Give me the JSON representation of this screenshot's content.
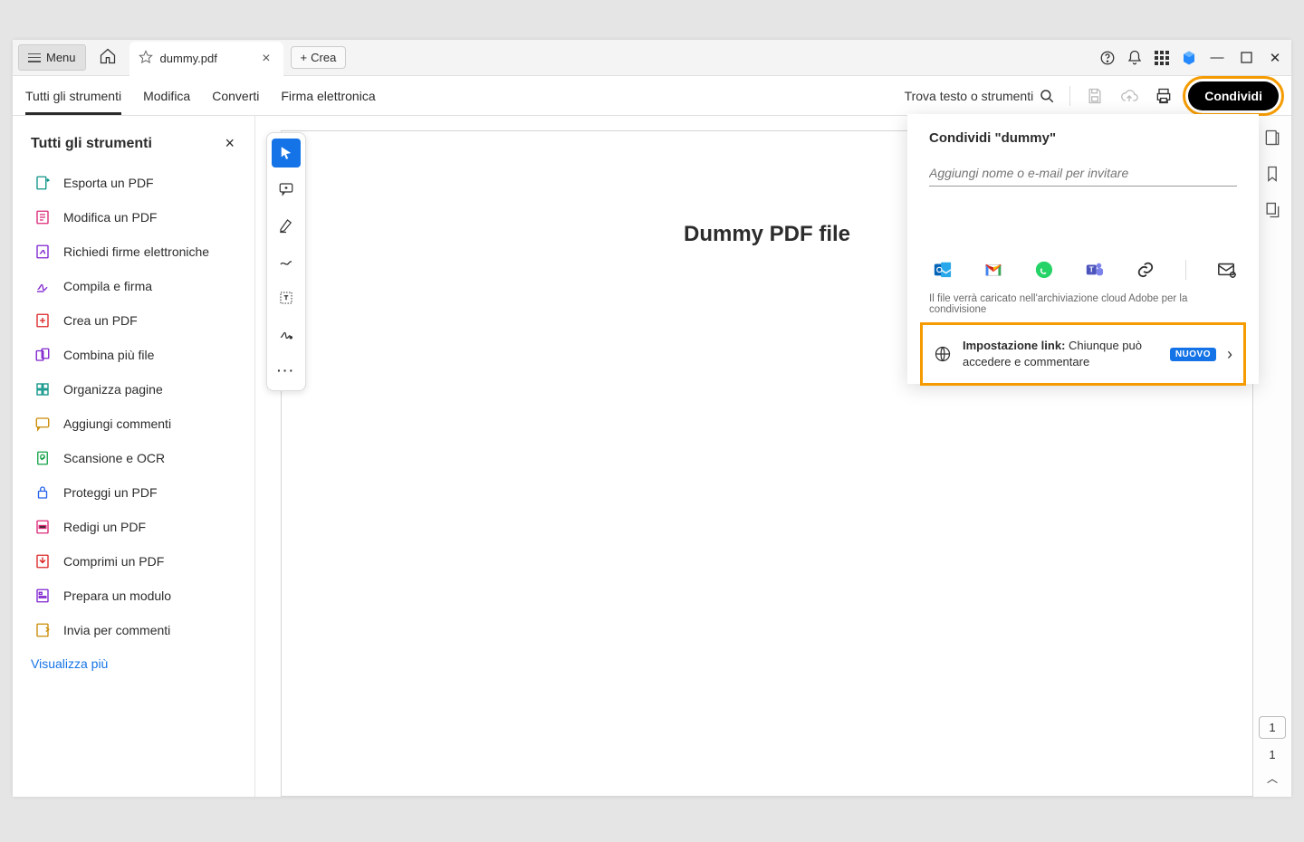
{
  "titlebar": {
    "menu_label": "Menu",
    "tab_name": "dummy.pdf",
    "new_tab_label": "Crea"
  },
  "toolbar": {
    "tabs": [
      "Tutti gli strumenti",
      "Modifica",
      "Converti",
      "Firma elettronica"
    ],
    "search_placeholder": "Trova testo o strumenti",
    "share_label": "Condividi"
  },
  "sidebar": {
    "title": "Tutti gli strumenti",
    "view_more": "Visualizza più",
    "items": [
      {
        "label": "Esporta un PDF",
        "color": "#0d9488"
      },
      {
        "label": "Modifica un PDF",
        "color": "#db2777"
      },
      {
        "label": "Richiedi firme elettroniche",
        "color": "#7e22ce"
      },
      {
        "label": "Compila e firma",
        "color": "#7e22ce"
      },
      {
        "label": "Crea un PDF",
        "color": "#dc2626"
      },
      {
        "label": "Combina più file",
        "color": "#7e22ce"
      },
      {
        "label": "Organizza pagine",
        "color": "#0d9488"
      },
      {
        "label": "Aggiungi commenti",
        "color": "#ca8a04"
      },
      {
        "label": "Scansione e OCR",
        "color": "#16a34a"
      },
      {
        "label": "Proteggi un PDF",
        "color": "#2563eb"
      },
      {
        "label": "Redigi un PDF",
        "color": "#db2777"
      },
      {
        "label": "Comprimi un PDF",
        "color": "#dc2626"
      },
      {
        "label": "Prepara un modulo",
        "color": "#7e22ce"
      },
      {
        "label": "Invia per commenti",
        "color": "#ca8a04"
      }
    ]
  },
  "document": {
    "content_heading": "Dummy PDF file"
  },
  "share_panel": {
    "title": "Condividi \"dummy\"",
    "invite_placeholder": "Aggiungi nome o e-mail per invitare",
    "cloud_note": "Il file verrà caricato nell'archiviazione cloud Adobe per la condivisione",
    "link_label": "Impostazione link:",
    "link_desc": "Chiunque può accedere e commentare",
    "badge": "NUOVO"
  },
  "page_indicator": {
    "current": "1",
    "total": "1"
  }
}
